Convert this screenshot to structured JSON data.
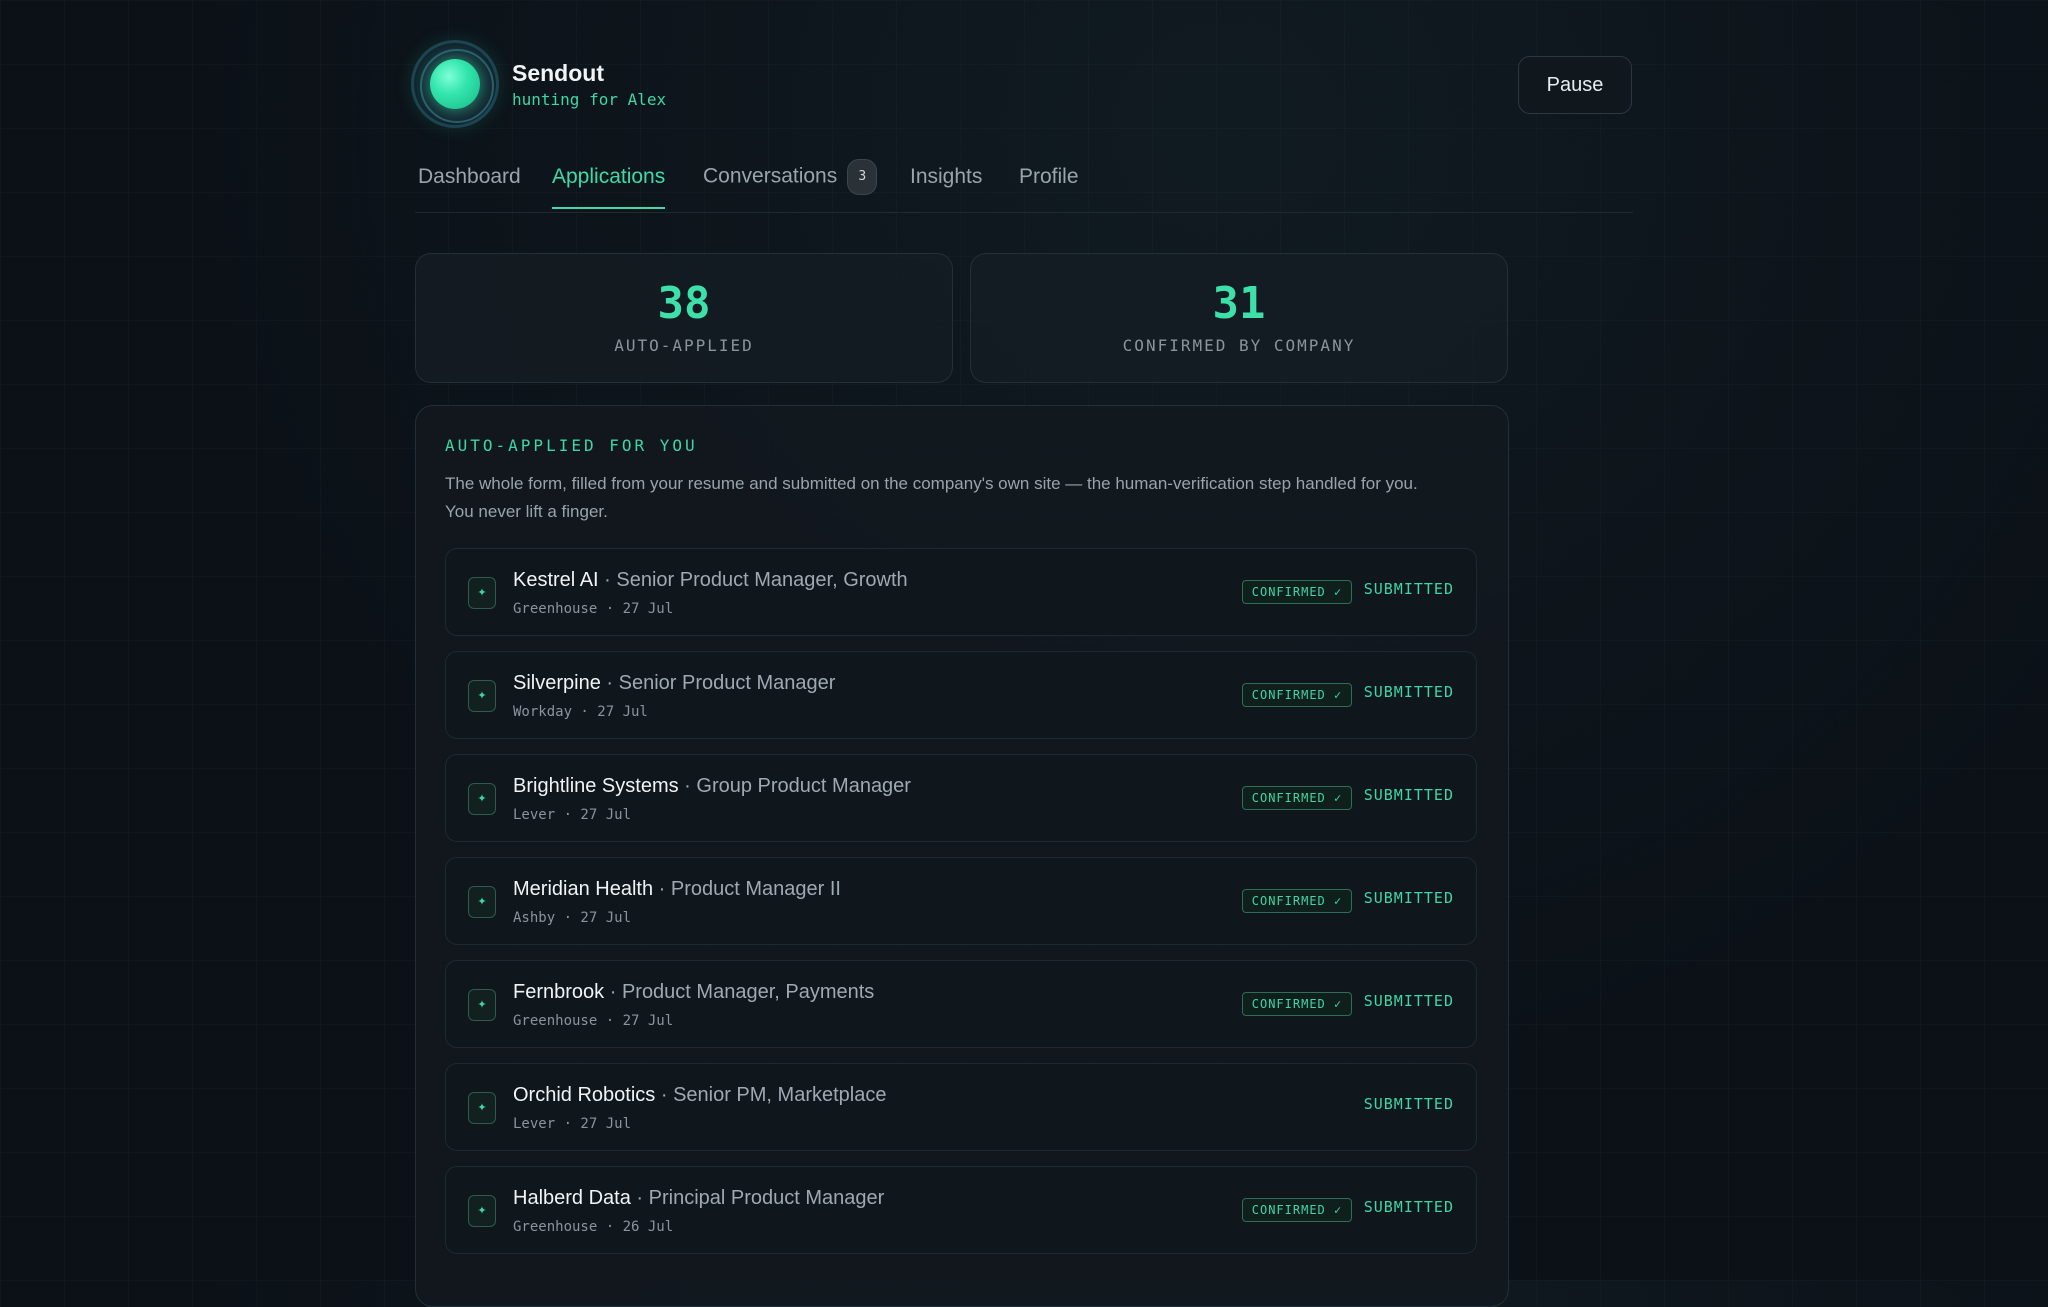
{
  "brand": {
    "name": "Sendout",
    "subtitle": "hunting for Alex"
  },
  "header": {
    "pause_label": "Pause"
  },
  "tabs": [
    {
      "label": "Dashboard"
    },
    {
      "label": "Applications",
      "active": true
    },
    {
      "label": "Conversations",
      "badge": "3"
    },
    {
      "label": "Insights"
    },
    {
      "label": "Profile"
    }
  ],
  "stats": {
    "auto_applied": {
      "value": "38",
      "label": "AUTO-APPLIED"
    },
    "confirmed": {
      "value": "31",
      "label": "CONFIRMED BY COMPANY"
    }
  },
  "panel": {
    "title": "AUTO-APPLIED FOR YOU",
    "description": "The whole form, filled from your resume and submitted on the company's own site — the human-verification step handled for you. You never lift a finger.",
    "separator": " · ",
    "confirmed_label": "CONFIRMED ✓",
    "status_label": "SUBMITTED",
    "rows": [
      {
        "company": "Kestrel AI",
        "role": "Senior Product Manager, Growth",
        "meta": "Greenhouse · 27 Jul",
        "confirmed": true
      },
      {
        "company": "Silverpine",
        "role": "Senior Product Manager",
        "meta": "Workday · 27 Jul",
        "confirmed": true
      },
      {
        "company": "Brightline Systems",
        "role": "Group Product Manager",
        "meta": "Lever · 27 Jul",
        "confirmed": true
      },
      {
        "company": "Meridian Health",
        "role": "Product Manager II",
        "meta": "Ashby · 27 Jul",
        "confirmed": true
      },
      {
        "company": "Fernbrook",
        "role": "Product Manager, Payments",
        "meta": "Greenhouse · 27 Jul",
        "confirmed": true
      },
      {
        "company": "Orchid Robotics",
        "role": "Senior PM, Marketplace",
        "meta": "Lever · 27 Jul",
        "confirmed": false
      },
      {
        "company": "Halberd Data",
        "role": "Principal Product Manager",
        "meta": "Greenhouse · 26 Jul",
        "confirmed": true
      }
    ]
  },
  "colors": {
    "accent": "#3ed6a4",
    "background": "#0b1117"
  },
  "icons": {
    "row_icon": "sparkle-icon",
    "logo": "orb-logo-icon"
  }
}
